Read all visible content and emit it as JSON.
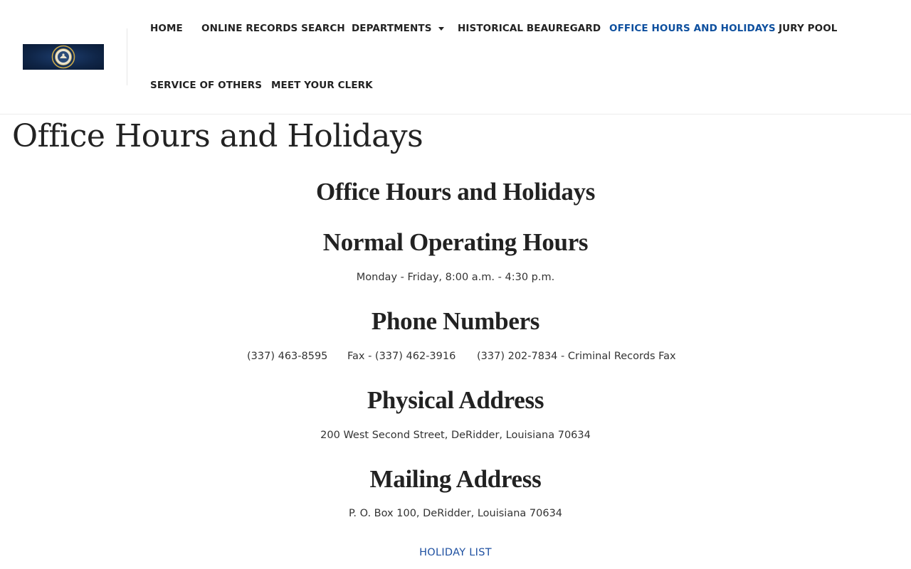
{
  "nav": {
    "items": [
      {
        "label": "HOME"
      },
      {
        "label": "ONLINE RECORDS SEARCH"
      },
      {
        "label": "DEPARTMENTS"
      },
      {
        "label": "HISTORICAL BEAUREGARD"
      },
      {
        "label": "OFFICE HOURS AND HOLIDAYS"
      },
      {
        "label": "JURY POOL"
      },
      {
        "label": "SERVICE OF OTHERS"
      },
      {
        "label": "MEET YOUR CLERK"
      }
    ],
    "active_color": "#0d4f9e"
  },
  "page": {
    "title": "Office Hours and Holidays"
  },
  "sections": {
    "main_heading": "Office Hours and Holidays",
    "hours": {
      "heading": "Normal Operating Hours",
      "text": "Monday - Friday, 8:00 a.m. - 4:30 p.m."
    },
    "phones": {
      "heading": "Phone Numbers",
      "items": [
        "(337) 463-8595",
        "Fax - (337) 462-3916",
        "(337) 202-7834 - Criminal Records Fax"
      ]
    },
    "physical": {
      "heading": "Physical Address",
      "text": "200 West Second Street, DeRidder, Louisiana 70634"
    },
    "mailing": {
      "heading": "Mailing Address",
      "text": "P. O. Box 100, DeRidder, Louisiana 70634"
    },
    "holiday_link": "HOLIDAY LIST"
  },
  "colors": {
    "link": "#1d4fa0",
    "logo_bg": "#0f2547"
  }
}
